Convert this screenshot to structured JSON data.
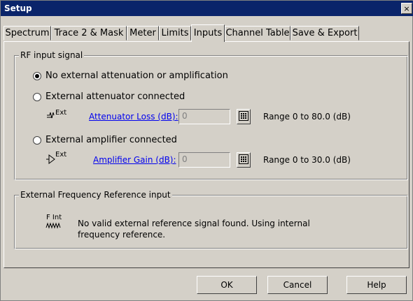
{
  "window": {
    "title": "Setup",
    "close_glyph": "×"
  },
  "tabs": [
    {
      "label": "Spectrum",
      "active": false
    },
    {
      "label": "Trace 2 & Mask",
      "active": false
    },
    {
      "label": "Meter",
      "active": false
    },
    {
      "label": "Limits",
      "active": false
    },
    {
      "label": "Inputs",
      "active": true
    },
    {
      "label": "Channel Table",
      "active": false
    },
    {
      "label": "Save & Export",
      "active": false
    }
  ],
  "rf_group": {
    "legend": "RF input signal",
    "options": [
      {
        "label": "No external attenuation or amplification",
        "selected": true
      },
      {
        "label": "External attenuator connected",
        "selected": false
      },
      {
        "label": "External amplifier connected",
        "selected": false
      }
    ],
    "attenuator": {
      "icon_text": "Ext",
      "link_label": "Attenuator Loss (dB):",
      "value": "0",
      "range": "Range 0 to 80.0 (dB)"
    },
    "amplifier": {
      "icon_text": "Ext",
      "link_label": "Amplifier Gain (dB):",
      "value": "0",
      "range": "Range 0 to 30.0 (dB)"
    }
  },
  "freq_group": {
    "legend": "External Frequency Reference input",
    "icon_text": "F Int",
    "message_line1": "No valid external reference signal found. Using internal",
    "message_line2": "frequency reference."
  },
  "buttons": {
    "ok": "OK",
    "cancel": "Cancel",
    "help": "Help"
  },
  "colors": {
    "titlebar": "#0a246a",
    "dialog_bg": "#d4d0c8",
    "link": "#0000ee"
  }
}
